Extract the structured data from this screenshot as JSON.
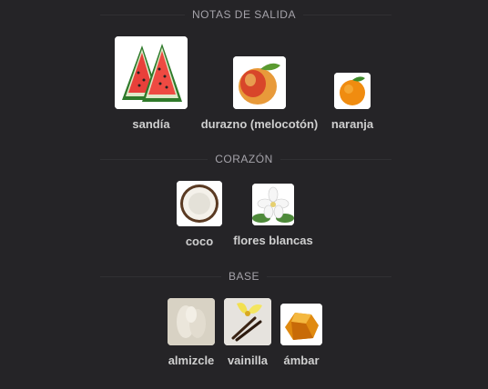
{
  "sections": [
    {
      "title": "NOTAS DE SALIDA",
      "notes": [
        {
          "label": "sandía",
          "icon": "watermelon-icon"
        },
        {
          "label": "durazno (melocotón)",
          "icon": "peach-icon"
        },
        {
          "label": "naranja",
          "icon": "orange-icon"
        }
      ]
    },
    {
      "title": "CORAZÓN",
      "notes": [
        {
          "label": "coco",
          "icon": "coconut-icon"
        },
        {
          "label": "flores blancas",
          "icon": "white-flowers-icon"
        }
      ]
    },
    {
      "title": "BASE",
      "notes": [
        {
          "label": "almizcle",
          "icon": "musk-icon"
        },
        {
          "label": "vainilla",
          "icon": "vanilla-icon"
        },
        {
          "label": "ámbar",
          "icon": "amber-icon"
        }
      ]
    }
  ],
  "colors": {
    "background": "#252427",
    "title": "#a5a3aa",
    "label": "#cfcfcf"
  }
}
